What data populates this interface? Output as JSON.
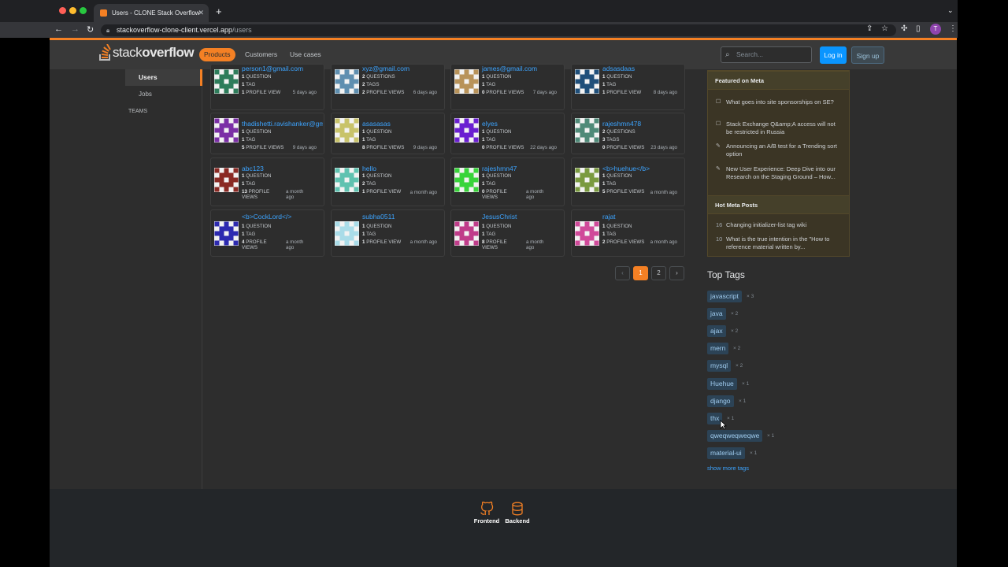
{
  "browser": {
    "tab_title": "Users - CLONE Stack Overflow",
    "url_host": "stackoverflow-clone-client.vercel.app",
    "url_path": "/users",
    "profile_initial": "T"
  },
  "header": {
    "logo_light": "stack",
    "logo_bold": "overflow",
    "nav": [
      "Products",
      "Customers",
      "Use cases"
    ],
    "search_placeholder": "Search...",
    "login": "Log in",
    "signup": "Sign up"
  },
  "sidebar": {
    "users": "Users",
    "jobs": "Jobs",
    "teams": "TEAMS"
  },
  "users": [
    {
      "name": "person1@gmail.com",
      "questions": "1",
      "questions_label": "QUESTION",
      "tags": "1",
      "tags_label": "TAG",
      "views": "1",
      "views_label": "PROFILE VIEW",
      "when": "5 days ago",
      "color": "#2e7d5b"
    },
    {
      "name": "xyz@gmail.com",
      "questions": "2",
      "questions_label": "QUESTIONS",
      "tags": "2",
      "tags_label": "TAGS",
      "views": "2",
      "views_label": "PROFILE VIEWS",
      "when": "6 days ago",
      "color": "#5f8fb0"
    },
    {
      "name": "james@gmail.com",
      "questions": "1",
      "questions_label": "QUESTION",
      "tags": "1",
      "tags_label": "TAG",
      "views": "0",
      "views_label": "PROFILE VIEWS",
      "when": "7 days ago",
      "color": "#b8935a"
    },
    {
      "name": "adsasdaas",
      "questions": "1",
      "questions_label": "QUESTION",
      "tags": "1",
      "tags_label": "TAG",
      "views": "1",
      "views_label": "PROFILE VIEW",
      "when": "8 days ago",
      "color": "#1f4f7a"
    },
    {
      "name": "thadishetti.ravishanker@gmail.com",
      "questions": "1",
      "questions_label": "QUESTION",
      "tags": "1",
      "tags_label": "TAG",
      "views": "5",
      "views_label": "PROFILE VIEWS",
      "when": "9 days ago",
      "color": "#7b2fa6"
    },
    {
      "name": "asasasas",
      "questions": "1",
      "questions_label": "QUESTION",
      "tags": "1",
      "tags_label": "TAG",
      "views": "8",
      "views_label": "PROFILE VIEWS",
      "when": "9 days ago",
      "color": "#c8c36a"
    },
    {
      "name": "elyes",
      "questions": "1",
      "questions_label": "QUESTION",
      "tags": "1",
      "tags_label": "TAG",
      "views": "0",
      "views_label": "PROFILE VIEWS",
      "when": "22 days ago",
      "color": "#6a1fd1"
    },
    {
      "name": "rajeshmn478",
      "questions": "2",
      "questions_label": "QUESTIONS",
      "tags": "3",
      "tags_label": "TAGS",
      "views": "0",
      "views_label": "PROFILE VIEWS",
      "when": "23 days ago",
      "color": "#4f8a78"
    },
    {
      "name": "abc123",
      "questions": "1",
      "questions_label": "QUESTION",
      "tags": "1",
      "tags_label": "TAG",
      "views": "13",
      "views_label": "PROFILE VIEWS",
      "when": "a month ago",
      "color": "#8a2a24"
    },
    {
      "name": "hello",
      "questions": "1",
      "questions_label": "QUESTION",
      "tags": "2",
      "tags_label": "TAG",
      "views": "1",
      "views_label": "PROFILE VIEW",
      "when": "a month ago",
      "color": "#5fc2b0"
    },
    {
      "name": "rajeshmn47",
      "questions": "1",
      "questions_label": "QUESTION",
      "tags": "1",
      "tags_label": "TAG",
      "views": "0",
      "views_label": "PROFILE VIEWS",
      "when": "a month ago",
      "color": "#38d43a"
    },
    {
      "name": "<b>huehue</b>",
      "questions": "1",
      "questions_label": "QUESTION",
      "tags": "1",
      "tags_label": "TAG",
      "views": "5",
      "views_label": "PROFILE VIEWS",
      "when": "a month ago",
      "color": "#7a9a40"
    },
    {
      "name": "<b>CockLord</>",
      "questions": "1",
      "questions_label": "QUESTION",
      "tags": "1",
      "tags_label": "TAG",
      "views": "4",
      "views_label": "PROFILE VIEWS",
      "when": "a month ago",
      "color": "#2d2ab0"
    },
    {
      "name": "subha0511",
      "questions": "1",
      "questions_label": "QUESTION",
      "tags": "1",
      "tags_label": "TAG",
      "views": "1",
      "views_label": "PROFILE VIEW",
      "when": "a month ago",
      "color": "#a9dce8"
    },
    {
      "name": "JesusChrist",
      "questions": "1",
      "questions_label": "QUESTION",
      "tags": "1",
      "tags_label": "TAG",
      "views": "8",
      "views_label": "PROFILE VIEWS",
      "when": "a month ago",
      "color": "#c03c8a"
    },
    {
      "name": "rajat",
      "questions": "1",
      "questions_label": "QUESTION",
      "tags": "1",
      "tags_label": "TAG",
      "views": "2",
      "views_label": "PROFILE VIEWS",
      "when": "a month ago",
      "color": "#d04a9a"
    }
  ],
  "pagination": {
    "prev": "‹",
    "pages": [
      "1",
      "2"
    ],
    "next": "›",
    "current": "1"
  },
  "meta": {
    "featured_title": "Featured on Meta",
    "featured": [
      {
        "icon": "checkbox-icon",
        "text": "What goes into site sponsorships on SE?"
      },
      {
        "icon": "checkbox-icon",
        "text": "Stack Exchange Q&amp;A access will not be restricted in Russia"
      },
      {
        "icon": "pencil-icon",
        "text": "Announcing an A/B test for a Trending sort option"
      },
      {
        "icon": "pencil-icon",
        "text": "New User Experience: Deep Dive into our Research on the Staging Ground – How..."
      }
    ],
    "hot_title": "Hot Meta Posts",
    "hot": [
      {
        "count": "16",
        "text": "Changing initializer-list tag wiki"
      },
      {
        "count": "10",
        "text": "What is the true intention in the \"How to reference material written by..."
      }
    ]
  },
  "top_tags": {
    "title": "Top Tags",
    "tags": [
      {
        "name": "javascript",
        "count": "× 3"
      },
      {
        "name": "java",
        "count": "× 2"
      },
      {
        "name": "ajax",
        "count": "× 2"
      },
      {
        "name": "mern",
        "count": "× 2"
      },
      {
        "name": "mysql",
        "count": "× 2"
      },
      {
        "name": "Huehue",
        "count": "× 1"
      },
      {
        "name": "django",
        "count": "× 1"
      },
      {
        "name": "thx",
        "count": "× 1"
      },
      {
        "name": "qweqweqweqwe",
        "count": "× 1"
      },
      {
        "name": "material-ui",
        "count": "× 1"
      }
    ],
    "show_more": "show more tags"
  },
  "footer": {
    "frontend": "Frontend",
    "backend": "Backend"
  },
  "colors": {
    "accent": "#f48024",
    "link": "#3ca4ff",
    "tag_bg": "#2c4356"
  }
}
